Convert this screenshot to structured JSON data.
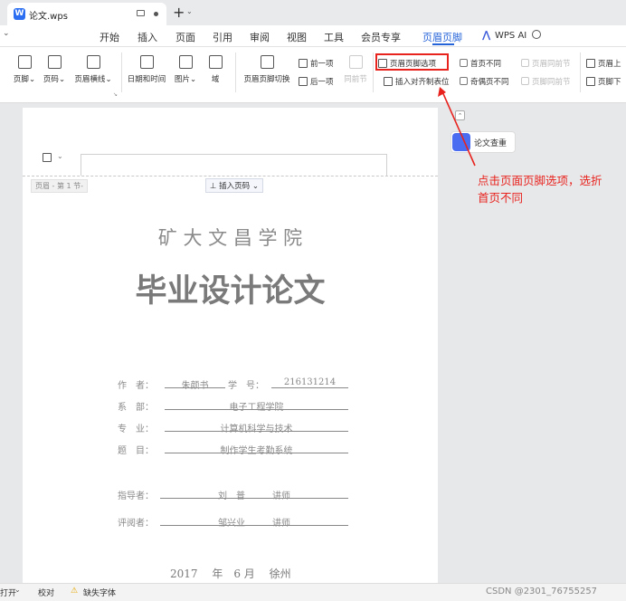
{
  "tab": {
    "title": "论文.wps"
  },
  "menu": [
    "开始",
    "插入",
    "页面",
    "引用",
    "审阅",
    "视图",
    "工具",
    "会员专享",
    "页眉页脚"
  ],
  "wps_ai": "WPS AI",
  "ribbon": {
    "btns": [
      "页脚",
      "页码",
      "页眉横线",
      "日期和时间",
      "图片",
      "域",
      "页眉页脚切换"
    ],
    "prev": "前一项",
    "next": "后一项",
    "same_section": "同前节",
    "options": "页眉页脚选项",
    "insert_align": "插入对齐制表位",
    "first_diff": "首页不同",
    "odd_even_diff": "奇偶页不同",
    "header_same_prev": "页眉同前节",
    "footer_same_prev": "页脚同前节",
    "header_up": "页眉上",
    "footer_down": "页脚下"
  },
  "float": {
    "paper_check": "论文查重"
  },
  "annotation": {
    "line1": "点击页面页脚选项，选折",
    "line2": "首页不同"
  },
  "doc": {
    "header_label": "页眉 - 第 1 节-",
    "insert_page_num": "插入页码",
    "school": "矿 大 文 昌 学 院",
    "title": "毕业设计论文",
    "author_label": "作　者：",
    "author": "朱颜书",
    "student_no_label": "学　号：",
    "student_no": "216131214",
    "dept_label": "系　部：",
    "dept": "电子工程学院",
    "major_label": "专　业：",
    "major": "计算机科学与技术",
    "topic_label": "题　目：",
    "topic": "制作学生考勤系统",
    "advisor_label": "指导者：",
    "advisor": "刘　普　　　讲师",
    "reviewer_label": "评阅者：",
    "reviewer": "邹兴业　　　讲师",
    "date": "2017　 年　6 月　 徐州"
  },
  "status": {
    "open": "打开",
    "proof": "校对",
    "missing_font": "缺失字体",
    "watermark": "CSDN @2301_76755257"
  },
  "colors": {
    "accent": "#2563d8",
    "annotation": "#e8231e"
  }
}
